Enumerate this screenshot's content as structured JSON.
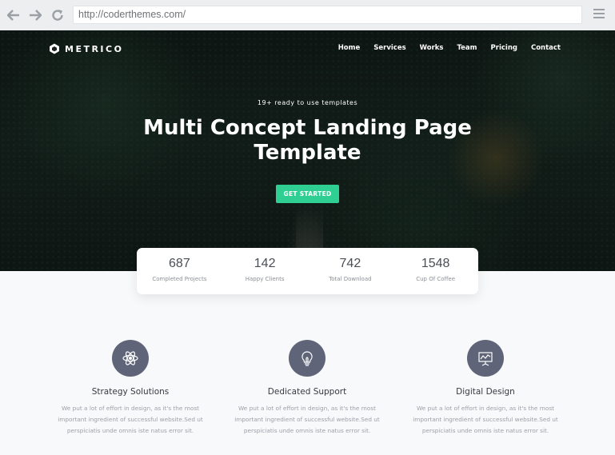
{
  "browser": {
    "url": "http://coderthemes.com/"
  },
  "brand": {
    "name": "METRICO"
  },
  "nav": {
    "items": [
      "Home",
      "Services",
      "Works",
      "Team",
      "Pricing",
      "Contact"
    ]
  },
  "hero": {
    "subtitle": "19+ ready to use templates",
    "title_line1": "Multi Concept Landing Page",
    "title_line2": "Template",
    "cta_label": "GET STARTED"
  },
  "stats": [
    {
      "value": "687",
      "label": "Completed Projects"
    },
    {
      "value": "142",
      "label": "Happy Clients"
    },
    {
      "value": "742",
      "label": "Total Download"
    },
    {
      "value": "1548",
      "label": "Cup Of Coffee"
    }
  ],
  "features": [
    {
      "icon": "atom-icon",
      "title": "Strategy Solutions",
      "text_line1": "We put a lot of effort in design, as it's the most",
      "text_line2": "important ingredient of successful website.Sed ut",
      "text_line3": "perspiciatis unde omnis iste natus error sit."
    },
    {
      "icon": "lightbulb-icon",
      "title": "Dedicated Support",
      "text_line1": "We put a lot of effort in design, as it's the most",
      "text_line2": "important ingredient of successful website.Sed ut",
      "text_line3": "perspiciatis unde omnis iste natus error sit."
    },
    {
      "icon": "presentation-icon",
      "title": "Digital Design",
      "text_line1": "We put a lot of effort in design, as it's the most",
      "text_line2": "important ingredient of successful website.Sed ut",
      "text_line3": "perspiciatis unde omnis iste natus error sit."
    }
  ],
  "colors": {
    "accent": "#2fcf93",
    "icon_circle": "#5f6478"
  }
}
